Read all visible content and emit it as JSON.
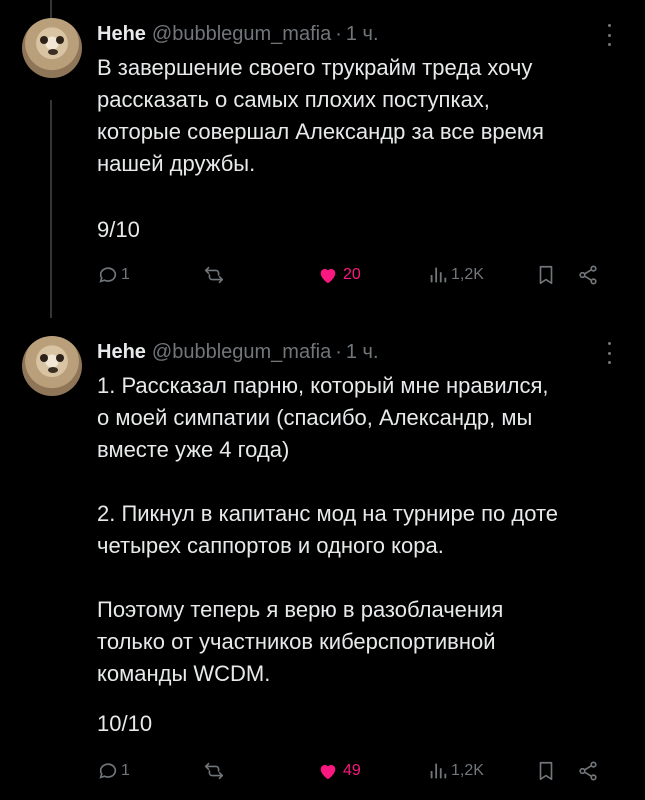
{
  "colors": {
    "background": "#000000",
    "text": "#e7e9ea",
    "muted": "#71767b",
    "like": "#f91880"
  },
  "tweets": [
    {
      "name": "Hehe",
      "handle": "@bubblegum_mafia",
      "separator": "·",
      "time": "1 ч.",
      "text": "В завершение своего трукрайм треда хочу\nрассказать о самых плохих поступках,\nкоторые совершал Александр за все время\nнашей дружбы.",
      "counter": "9/10",
      "replies": "1",
      "likes": "20",
      "views": "1,2K",
      "liked": true
    },
    {
      "name": "Hehe",
      "handle": "@bubblegum_mafia",
      "separator": "·",
      "time": "1 ч.",
      "text": "1. Рассказал парню, который мне нравился,\nо моей симпатии (спасибо, Александр, мы\nвместе уже 4 года)\n\n2. Пикнул в капитанс мод на турнире по доте\nчетырех саппортов и одного кора.\n\nПоэтому теперь я верю в разоблачения\nтолько от участников киберспортивной\nкоманды WCDM.",
      "counter": "10/10",
      "replies": "1",
      "likes": "49",
      "views": "1,2K",
      "liked": true
    }
  ]
}
